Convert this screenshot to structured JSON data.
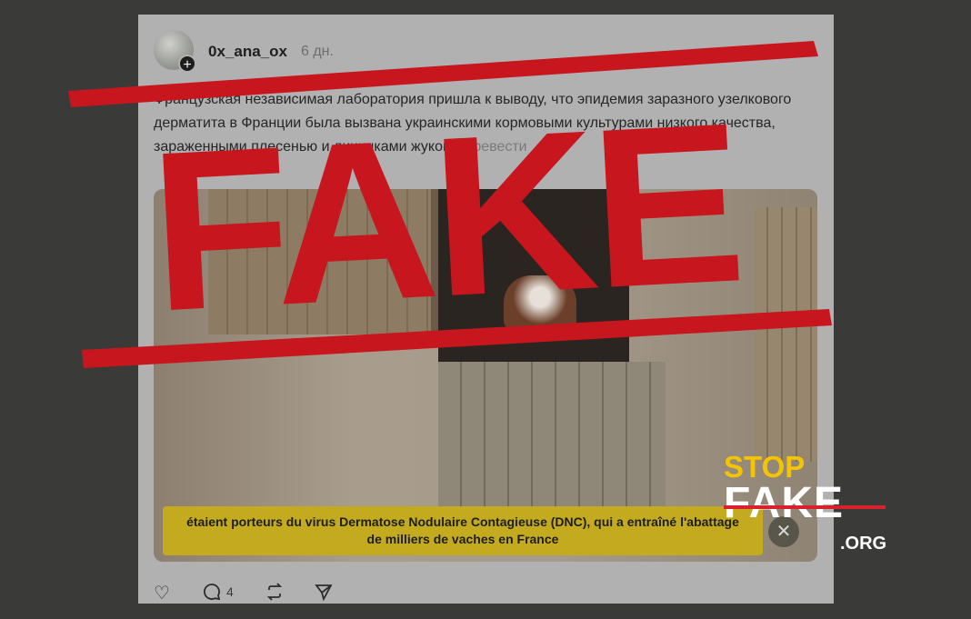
{
  "post": {
    "username": "0x_ana_ox",
    "time": "6 дн.",
    "text": "Французская независимая лаборатория пришла к выводу, что эпидемия заразного узелкового дерматита в Франции была вызвана украинскими кормовыми культурами низкого качества, зараженными плесенью и личинками жуков",
    "more": "Перевести",
    "video_caption_line1": "étaient porteurs du virus Dermatose Nodulaire Contagieuse (DNC), qui a entraîné l'abattage",
    "video_caption_line2": "de milliers de vaches en France",
    "reply_count": "4"
  },
  "stamp": {
    "text": "FAKE",
    "color": "#c8161e"
  },
  "logo": {
    "stop": "STOP",
    "fake": "FAKE",
    "org": ".ORG",
    "stop_color": "#f5c400",
    "fake_color": "#ffffff",
    "strike_color": "#d8212a"
  },
  "icons": {
    "like": "heart-icon",
    "reply": "comment-icon",
    "repost": "repost-icon",
    "share": "send-icon",
    "close": "close-icon",
    "follow": "plus-icon"
  }
}
